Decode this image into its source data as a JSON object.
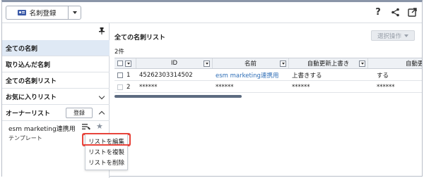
{
  "toolbar": {
    "register_label": "名刺登録"
  },
  "sidebar": {
    "items": [
      {
        "label": "全ての名刺"
      },
      {
        "label": "取り込んだ名刺"
      },
      {
        "label": "全ての名刺リスト"
      },
      {
        "label": "お気に入りリスト"
      },
      {
        "label": "オーナーリスト"
      }
    ],
    "owner_register_label": "登録",
    "list_name": "esm marketing連携用",
    "list_type": "テンプレート",
    "context_menu": [
      "リストを編集",
      "リストを複製",
      "リストを削除"
    ]
  },
  "main": {
    "title": "全ての名刺リスト",
    "count": "2件",
    "ops_label": "選択操作",
    "columns": [
      "ID",
      "名前",
      "自動更新上書き",
      "自動更新"
    ],
    "rows": [
      {
        "num": "1",
        "id": "45262303314502",
        "name": "esm marketing連携用",
        "overwrite": "上書きする",
        "auto": "する"
      },
      {
        "num": "2",
        "id": "******",
        "name": "******",
        "overwrite": "******",
        "auto": "******"
      }
    ]
  },
  "colors": {
    "active_bg": "#dfe9f5",
    "link": "#2d6db6",
    "highlight": "#e8453c"
  }
}
